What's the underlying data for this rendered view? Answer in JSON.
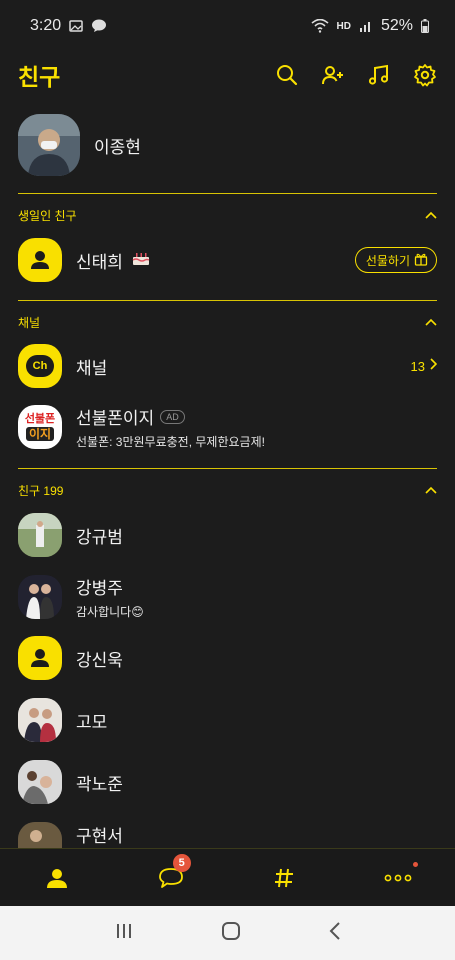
{
  "status_bar": {
    "time": "3:20",
    "network": "HD",
    "battery": "52%"
  },
  "header": {
    "title": "친구"
  },
  "my_profile": {
    "name": "이종현"
  },
  "birthday_section": {
    "title": "생일인 친구",
    "friend_name": "신태희",
    "gift_button": "선물하기"
  },
  "channel_section": {
    "title": "채널",
    "channel_label": "채널",
    "channel_count": "13",
    "ch_badge": "Ch",
    "ad_item": {
      "name": "선불폰이지",
      "ad_tag": "AD",
      "description": "선불폰: 3만원무료충전, 무제한요금제!",
      "logo_line1": "선불폰",
      "logo_line2": "이지"
    }
  },
  "friends_section": {
    "title": "친구 199",
    "friends": [
      {
        "name": "강규범",
        "status": ""
      },
      {
        "name": "강병주",
        "status": "감사합니다😊"
      },
      {
        "name": "강신욱",
        "status": ""
      },
      {
        "name": "고모",
        "status": ""
      },
      {
        "name": "곽노준",
        "status": ""
      },
      {
        "name": "구현서",
        "status": ""
      }
    ]
  },
  "tab_bar": {
    "chat_badge": "5"
  },
  "colors": {
    "accent": "#f9e000",
    "background": "#1c1c1c",
    "badge": "#e5553b"
  }
}
